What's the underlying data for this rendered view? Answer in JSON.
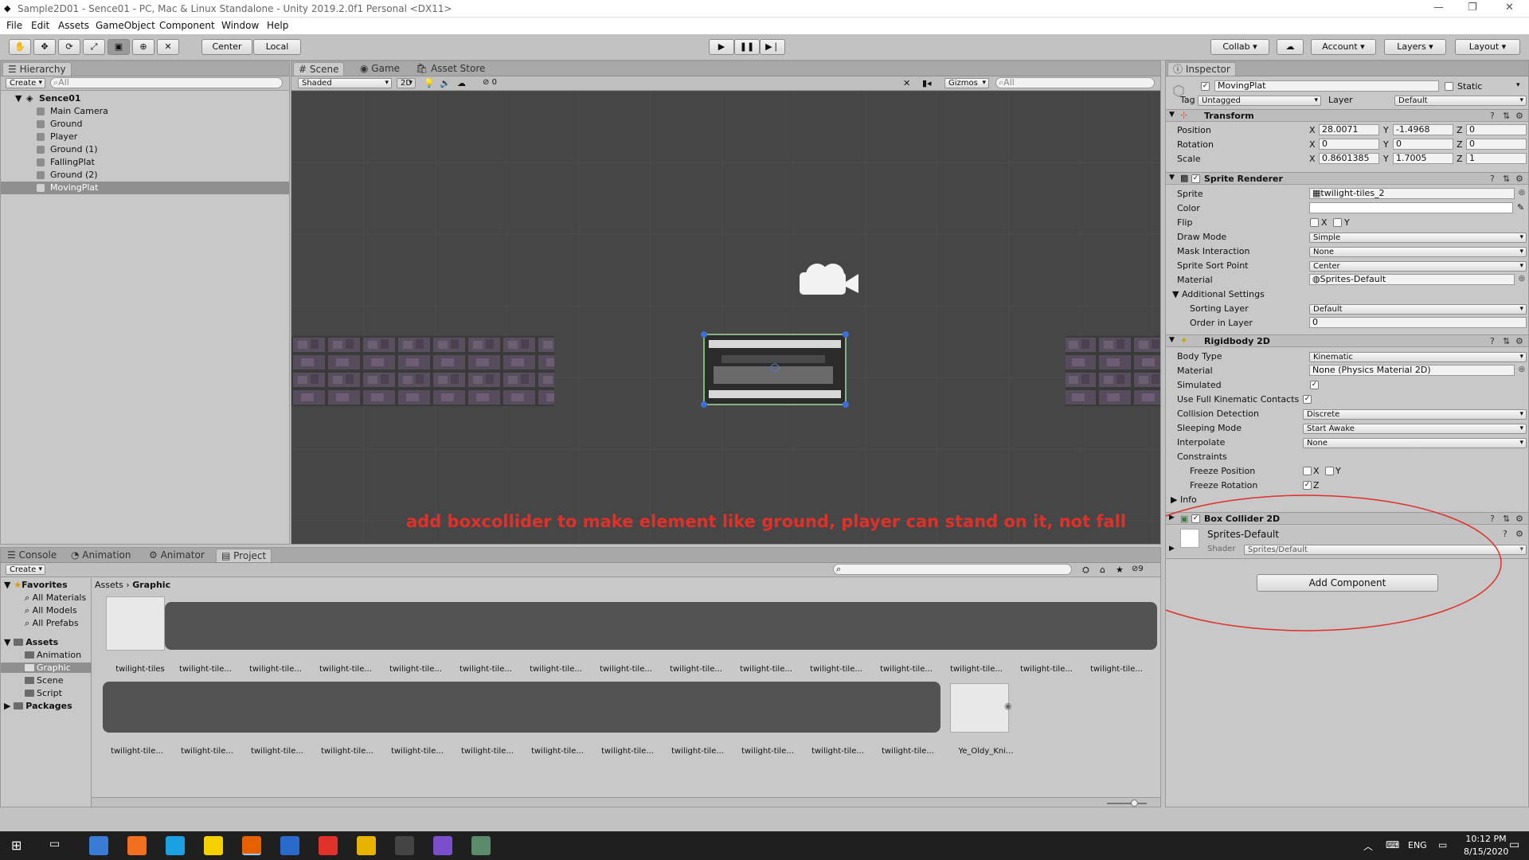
{
  "window": {
    "title": "Sample2D01 - Sence01 - PC, Mac & Linux Standalone - Unity 2019.2.0f1 Personal <DX11>"
  },
  "menu": [
    "File",
    "Edit",
    "Assets",
    "GameObject",
    "Component",
    "Window",
    "Help"
  ],
  "toolbar": {
    "center": "Center",
    "local": "Local",
    "collab": "Collab",
    "account": "Account",
    "layers": "Layers",
    "layout": "Layout"
  },
  "hierarchy": {
    "tab": "Hierarchy",
    "create": "Create",
    "search_placeholder": "All",
    "scene": "Sence01",
    "items": [
      "Main Camera",
      "Ground",
      "Player",
      "Ground (1)",
      "FallingPlat",
      "Ground (2)",
      "MovingPlat"
    ]
  },
  "scene_view": {
    "tabs": [
      "Scene",
      "Game",
      "Asset Store"
    ],
    "shading": "Shaded",
    "mode_2d": "2D",
    "hidden_count": "0",
    "gizmos": "Gizmos",
    "search_placeholder": "All",
    "annotation": "add boxcollider to make element like ground, player can stand on it, not fall"
  },
  "inspector": {
    "tab": "Inspector",
    "object_name": "MovingPlat",
    "static_label": "Static",
    "tag_label": "Tag",
    "tag_value": "Untagged",
    "layer_label": "Layer",
    "layer_value": "Default",
    "transform": {
      "title": "Transform",
      "position_label": "Position",
      "rotation_label": "Rotation",
      "scale_label": "Scale",
      "position": {
        "x": "28.0071",
        "y": "-1.4968",
        "z": "0"
      },
      "rotation": {
        "x": "0",
        "y": "0",
        "z": "0"
      },
      "scale": {
        "x": "0.8601385",
        "y": "1.7005",
        "z": "1"
      }
    },
    "sprite_renderer": {
      "title": "Sprite Renderer",
      "sprite_label": "Sprite",
      "sprite": "twilight-tiles_2",
      "color_label": "Color",
      "flip_label": "Flip",
      "flip_x": "X",
      "flip_y": "Y",
      "draw_mode_label": "Draw Mode",
      "draw_mode": "Simple",
      "mask_label": "Mask Interaction",
      "mask": "None",
      "sort_point_label": "Sprite Sort Point",
      "sort_point": "Center",
      "material_label": "Material",
      "material": "Sprites-Default",
      "additional": "Additional Settings",
      "sorting_layer_label": "Sorting Layer",
      "sorting_layer": "Default",
      "order_label": "Order in Layer",
      "order": "0"
    },
    "rigidbody": {
      "title": "Rigidbody 2D",
      "body_type_label": "Body Type",
      "body_type": "Kinematic",
      "material_label": "Material",
      "material": "None (Physics Material 2D)",
      "simulated_label": "Simulated",
      "full_kinematic_label": "Use Full Kinematic Contacts",
      "collision_label": "Collision Detection",
      "collision": "Discrete",
      "sleeping_label": "Sleeping Mode",
      "sleeping": "Start Awake",
      "interpolate_label": "Interpolate",
      "interpolate": "None",
      "constraints_label": "Constraints",
      "freeze_pos_label": "Freeze Position",
      "freeze_rot_label": "Freeze Rotation",
      "x": "X",
      "y": "Y",
      "z": "Z",
      "info_label": "Info"
    },
    "box_collider": {
      "title": "Box Collider 2D"
    },
    "material_preview": {
      "name": "Sprites-Default",
      "shader_label": "Shader",
      "shader": "Sprites/Default"
    },
    "add_component": "Add Component"
  },
  "bottom_tabs": [
    "Console",
    "Animation",
    "Animator",
    "Project"
  ],
  "project": {
    "create": "Create",
    "hidden_count": "9",
    "favorites_title": "Favorites",
    "favorites": [
      "All Materials",
      "All Models",
      "All Prefabs"
    ],
    "assets_title": "Assets",
    "folders": [
      "Animation",
      "Graphic",
      "Scene",
      "Script"
    ],
    "packages": "Packages",
    "breadcrumb": [
      "Assets",
      "Graphic"
    ],
    "row1": [
      "twilight-tiles",
      "twilight-tile...",
      "twilight-tile...",
      "twilight-tile...",
      "twilight-tile...",
      "twilight-tile...",
      "twilight-tile...",
      "twilight-tile...",
      "twilight-tile...",
      "twilight-tile...",
      "twilight-tile...",
      "twilight-tile...",
      "twilight-tile...",
      "twilight-tile...",
      "twilight-tile..."
    ],
    "row2": [
      "twilight-tile...",
      "twilight-tile...",
      "twilight-tile...",
      "twilight-tile...",
      "twilight-tile...",
      "twilight-tile...",
      "twilight-tile...",
      "twilight-tile...",
      "twilight-tile...",
      "twilight-tile...",
      "twilight-tile...",
      "twilight-tile...",
      "Ye_Oldy_Kni..."
    ]
  },
  "taskbar": {
    "time": "10:12 PM",
    "date": "8/15/2020",
    "lang": "ENG"
  },
  "colors": {
    "annotation": "#e0302a",
    "scene_bg": "#464646",
    "selection": "#8aa0c8"
  }
}
